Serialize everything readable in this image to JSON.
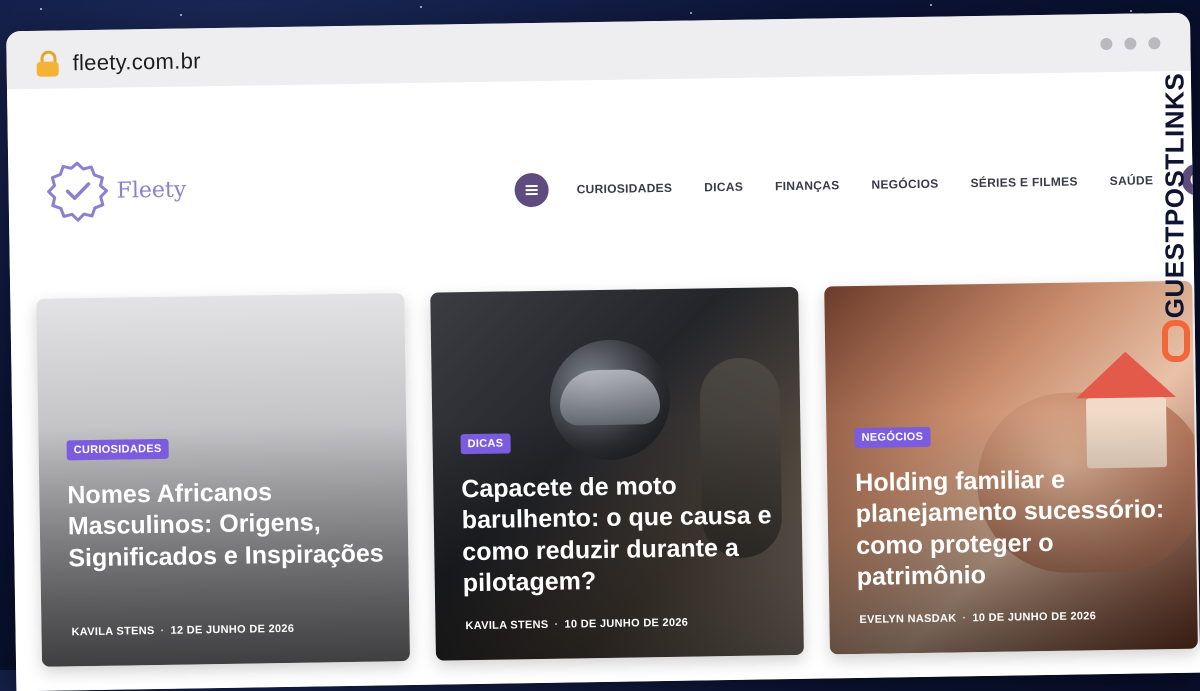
{
  "browser": {
    "url": "fleety.com.br"
  },
  "site": {
    "logo_text": "Fleety",
    "nav_items": [
      "CURIOSIDADES",
      "DICAS",
      "FINANÇAS",
      "NEGÓCIOS",
      "SÉRIES E FILMES",
      "SAÚDE"
    ]
  },
  "articles": [
    {
      "tag": "CURIOSIDADES",
      "title": "Nomes Africanos Masculinos: Origens, Significados e Inspirações",
      "author": "KAVILA STENS",
      "date": "12 DE JUNHO DE 2026"
    },
    {
      "tag": "DICAS",
      "title": "Capacete de moto barulhento: o que causa e como reduzir durante a pilotagem?",
      "author": "KAVILA STENS",
      "date": "10 DE JUNHO DE 2026"
    },
    {
      "tag": "NEGÓCIOS",
      "title": "Holding familiar e planejamento sucessório: como proteger o patrimônio",
      "author": "EVELYN NASDAK",
      "date": "10 DE JUNHO DE 2026"
    }
  ],
  "watermark": {
    "text": "GUESTPOSTLINKS"
  },
  "colors": {
    "accent": "#7b5cde",
    "nav_button": "#5e4c7f",
    "logo": "#8c7fd1",
    "watermark_link": "#f2663a"
  }
}
